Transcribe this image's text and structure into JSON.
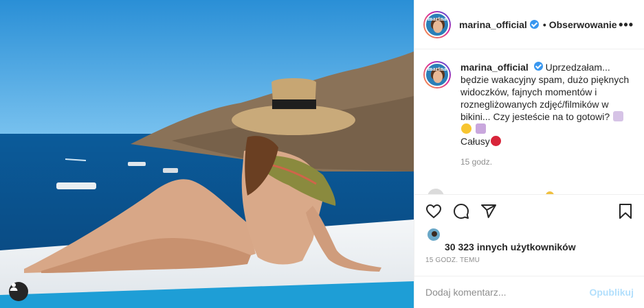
{
  "post": {
    "username": "marina_official",
    "separator": "•",
    "follow_label": "Obserwowanie",
    "more_label": "•••",
    "avatar_brand": "marina",
    "caption": {
      "username": "marina_official",
      "line1": "Uprzedzałam... będzie wakacyjny spam, dużo pięknych widoczków, fajnych momentów i roznegliżowanych zdjęć/filmików w bikini... Czy jesteście na to gotowi?",
      "line2": "Całusy",
      "time": "15 godz."
    },
    "likes": {
      "count_text": "30 323 innych użytkowników"
    },
    "timestamp": "15 GODZ. TEMU",
    "comment_placeholder": "Dodaj komentarz...",
    "publish_label": "Opublikuj"
  },
  "icons": {
    "like": "heart-icon",
    "comment": "comment-icon",
    "share": "share-icon",
    "save": "bookmark-icon",
    "user_tag": "user-tag-icon"
  },
  "colors": {
    "verified": "#3897f0",
    "publish_disabled": "#b2dffc",
    "muted_text": "#8e8e8e"
  }
}
